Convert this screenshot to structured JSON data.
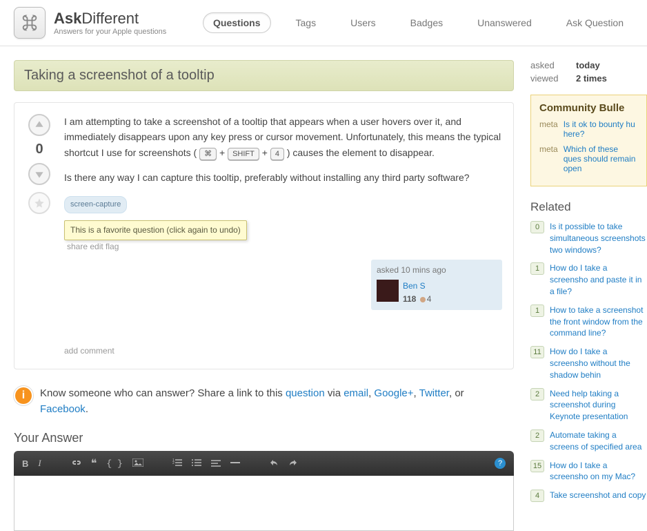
{
  "site": {
    "name_bold": "Ask",
    "name_light": "Different",
    "tagline": "Answers for your Apple questions"
  },
  "nav": {
    "questions": "Questions",
    "tags": "Tags",
    "users": "Users",
    "badges": "Badges",
    "unanswered": "Unanswered",
    "ask": "Ask Question"
  },
  "question": {
    "title": "Taking a screenshot of a tooltip",
    "score": "0",
    "body_p1_a": "I am attempting to take a screenshot of a tooltip that appears when a user hovers over it, and immediately disappears upon any key press or cursor movement. Unfortunately, this means the typical shortcut I use for screenshots (",
    "kbd1": "⌘",
    "plus1": "+",
    "kbd2": "SHIFT",
    "plus2": "+",
    "kbd3": "4",
    "body_p1_b": ") causes the element to disappear.",
    "body_p2": "Is there any way I can capture this tooltip, preferably without installing any third party software?",
    "tag": "screen-capture",
    "tooltip_text": "This is a favorite question (click again to undo)",
    "post_menu": "share  edit  flag",
    "asked_when": "asked 10 mins ago",
    "user_name": "Ben S",
    "user_rep": "118",
    "user_bronze": "4",
    "add_comment": "add comment"
  },
  "share": {
    "prefix": "Know someone who can answer? Share a link to this ",
    "question": "question",
    "via": " via ",
    "email": "email",
    "c1": ", ",
    "google": "Google+",
    "c2": ", ",
    "twitter": "Twitter",
    "or": ", or ",
    "facebook": "Facebook",
    "dot": "."
  },
  "answer_heading": "Your Answer",
  "toolbar": {
    "bold": "B",
    "italic": "I"
  },
  "stats": {
    "asked_lbl": "asked",
    "asked_val": "today",
    "viewed_lbl": "viewed",
    "viewed_val": "2 times"
  },
  "bulletin": {
    "heading": "Community Bulle",
    "meta": "meta",
    "item1": "Is it ok to bounty hu here?",
    "item2": "Which of these ques should remain open"
  },
  "related": {
    "heading": "Related",
    "items": [
      {
        "n": "0",
        "t": "Is it possible to take simultaneous screenshots two windows?"
      },
      {
        "n": "1",
        "t": "How do I take a screensho and paste it in a file?"
      },
      {
        "n": "1",
        "t": "How to take a screenshot the front window from the command line?"
      },
      {
        "n": "11",
        "t": "How do I take a screensho without the shadow behin"
      },
      {
        "n": "2",
        "t": "Need help taking a screenshot during Keynote presentation"
      },
      {
        "n": "2",
        "t": "Automate taking a screens of specified area"
      },
      {
        "n": "15",
        "t": "How do I take a screensho on my Mac?"
      },
      {
        "n": "4",
        "t": "Take screenshot and copy"
      }
    ]
  }
}
